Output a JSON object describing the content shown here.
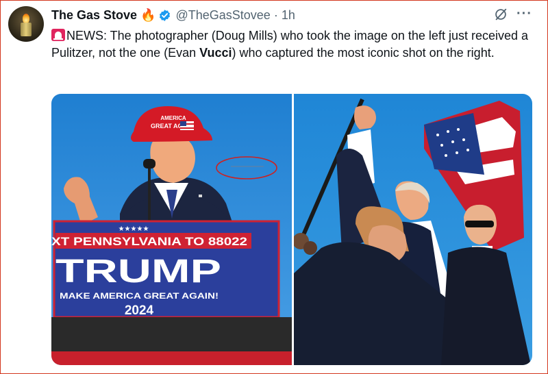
{
  "author": {
    "name": "The Gas Stove",
    "handle": "@TheGasStovee",
    "time": "1h"
  },
  "tweet": {
    "before_bold": "NEWS:  The photographer (Doug Mills) who took the image on the left just received a Pulitzer, not the one (Evan ",
    "bold": "Vucci",
    "after_bold": ") who captured the most iconic shot on the right."
  },
  "left_photo": {
    "hat_line1": "AMERICA",
    "hat_line2": "GREAT AGAIN",
    "podium_stars": "★★★★★",
    "podium_line1": "XT PENNSYLVANIA TO 88022",
    "podium_title": "TRUMP",
    "podium_line2": "MAKE AMERICA GREAT AGAIN!",
    "podium_year": "2024"
  },
  "icons": {
    "verified": "verified-badge-icon",
    "fire": "fire-icon",
    "siren": "siren-icon",
    "grok": "grok-icon",
    "more": "more-options-icon"
  },
  "colors": {
    "verified_blue": "#1d9bf0",
    "text": "#0f1419",
    "secondary": "#536471",
    "frame": "#d2361c"
  }
}
